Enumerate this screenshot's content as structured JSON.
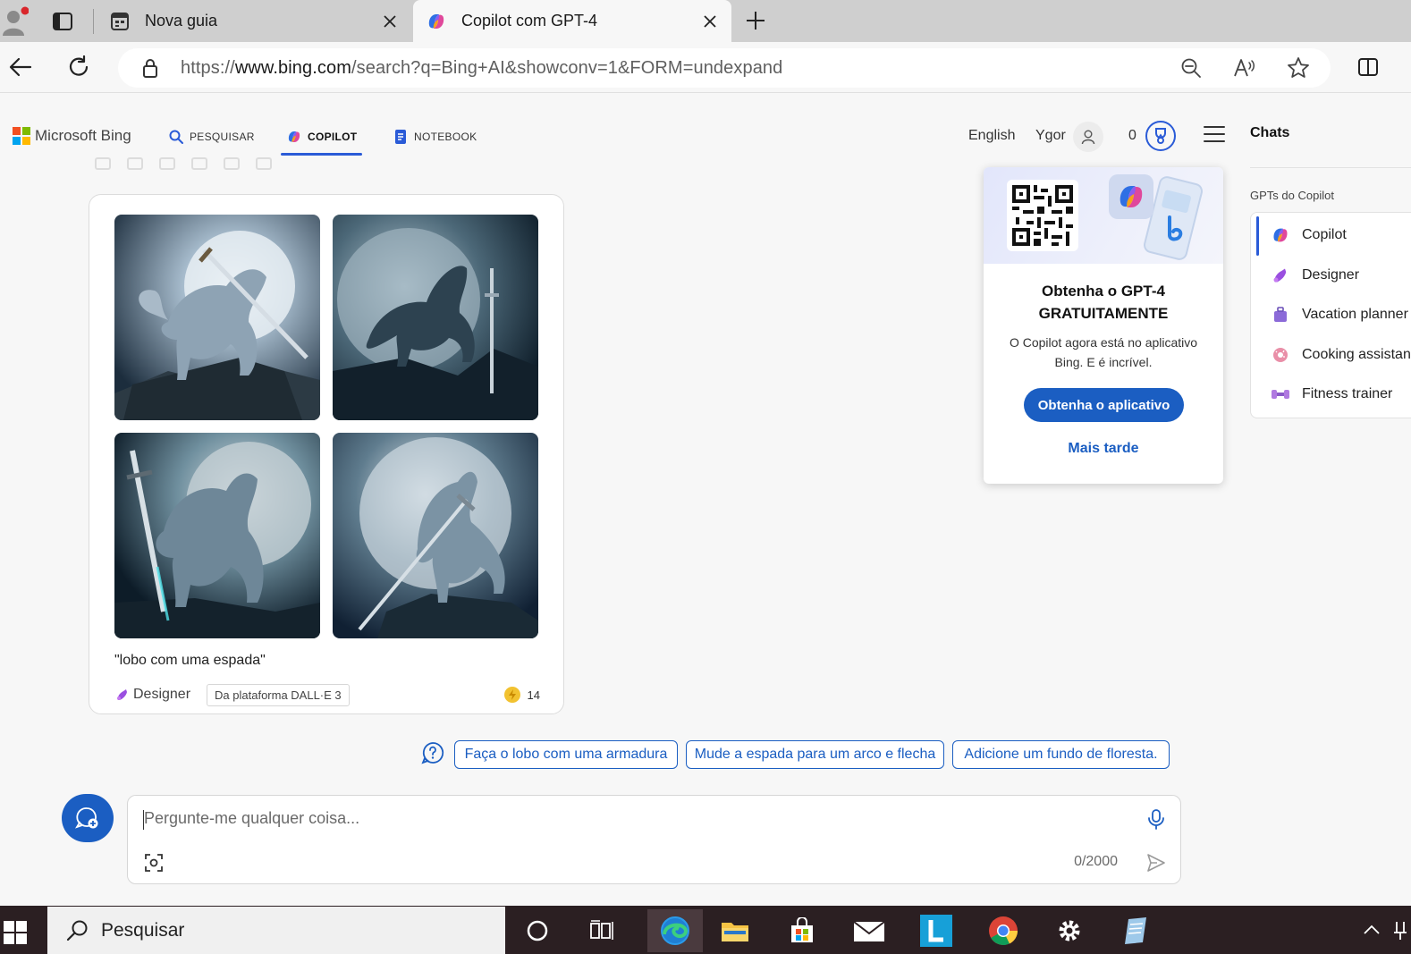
{
  "browser": {
    "tabs": [
      {
        "title": "Nova guia",
        "active": false
      },
      {
        "title": "Copilot com GPT-4",
        "active": true
      }
    ],
    "url_prefix": "https://",
    "url_host": "www.bing.com",
    "url_path": "/search?q=Bing+AI&showconv=1&FORM=undexpand"
  },
  "header": {
    "brand": "Microsoft Bing",
    "nav": [
      {
        "label": "PESQUISAR",
        "icon": "search-icon"
      },
      {
        "label": "COPILOT",
        "icon": "copilot-icon",
        "active": true
      },
      {
        "label": "NOTEBOOK",
        "icon": "notebook-icon"
      }
    ],
    "language": "English",
    "user_name": "Ygor",
    "rewards_count": "0"
  },
  "result_card": {
    "prompt_caption": "\"lobo com uma espada\"",
    "creator": "Designer",
    "platform_tag": "Da plataforma DALL·E 3",
    "boosts_remaining": "14",
    "images": [
      {
        "subject": "wolf-with-sword-1"
      },
      {
        "subject": "wolf-with-sword-2"
      },
      {
        "subject": "wolf-with-sword-3"
      },
      {
        "subject": "wolf-with-sword-4"
      }
    ]
  },
  "suggestions": [
    "Faça o lobo com uma armadura",
    "Mude a espada para um arco e flecha",
    "Adicione um fundo de floresta."
  ],
  "composer": {
    "placeholder": "Pergunte-me qualquer coisa...",
    "char_counter": "0/2000"
  },
  "promo": {
    "title_line1": "Obtenha o GPT-4",
    "title_line2": "GRATUITAMENTE",
    "description": "O Copilot agora está no aplicativo Bing. E é incrível.",
    "cta": "Obtenha o aplicativo",
    "later": "Mais tarde"
  },
  "sidebar": {
    "title": "Chats",
    "section_label": "GPTs do Copilot",
    "gpts": [
      {
        "label": "Copilot",
        "active": true
      },
      {
        "label": "Designer"
      },
      {
        "label": "Vacation planner"
      },
      {
        "label": "Cooking assistant"
      },
      {
        "label": "Fitness trainer"
      }
    ]
  },
  "taskbar": {
    "search_label": "Pesquisar"
  },
  "colors": {
    "accent": "#1b5ec2",
    "nav_active": "#2a5bd7",
    "taskbar": "#2b1f22"
  }
}
